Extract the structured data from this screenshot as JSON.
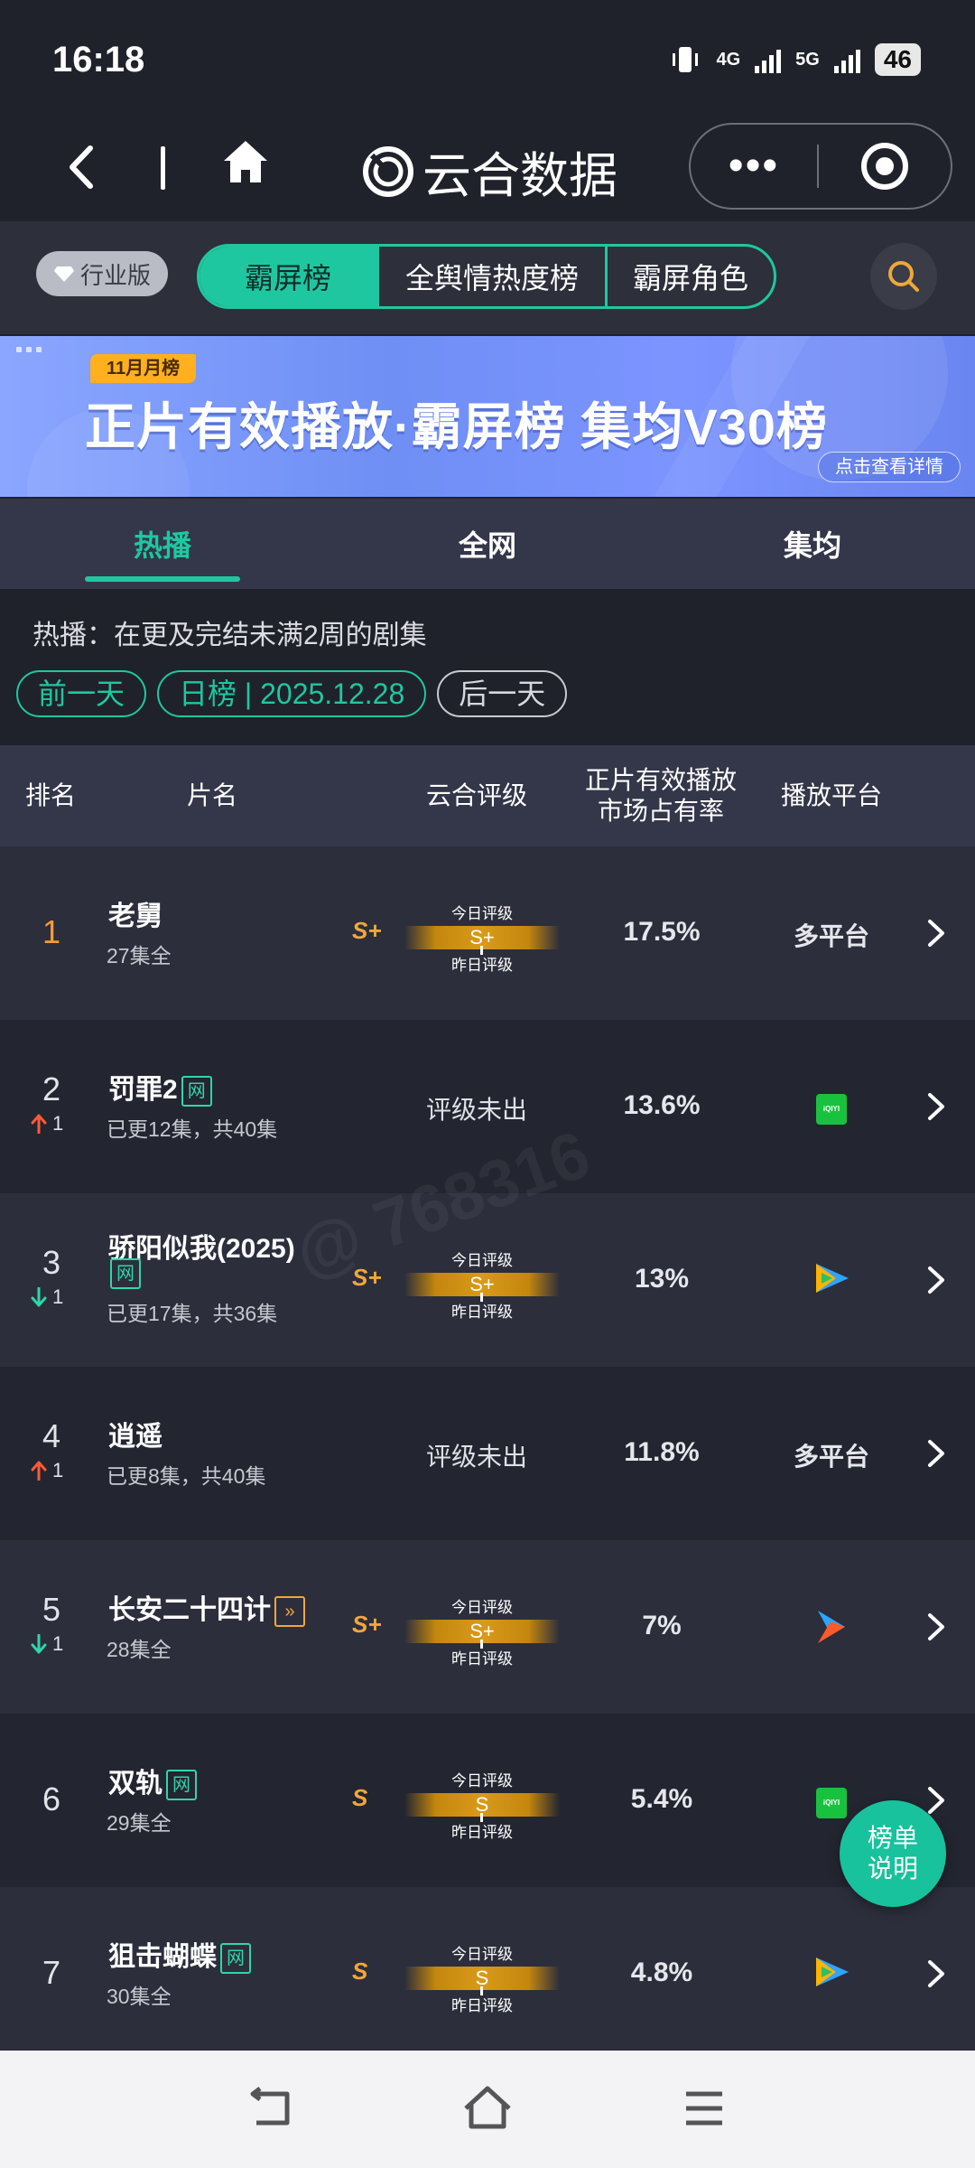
{
  "status": {
    "time": "16:18",
    "net1": "4G",
    "net2": "5G",
    "battery": "46"
  },
  "header": {
    "brand": "云合数据"
  },
  "top_tabs": {
    "edition": "行业版",
    "items": [
      "霸屏榜",
      "全舆情热度榜",
      "霸屏角色"
    ]
  },
  "banner": {
    "badge": "11月月榜",
    "title": "正片有效播放·霸屏榜 集均V30榜",
    "link": "点击查看详情"
  },
  "sub_tabs": [
    "热播",
    "全网",
    "集均"
  ],
  "description": "热播：在更及完结未满2周的剧集",
  "date_nav": {
    "prev": "前一天",
    "current": "日榜 | 2025.12.28",
    "next": "后一天"
  },
  "columns": [
    "排名",
    "片名",
    "云合评级",
    "正片有效播放\n市场占有率",
    "播放平台"
  ],
  "grade_labels": {
    "today": "今日评级",
    "yesterday": "昨日评级",
    "none": "评级未出"
  },
  "rows": [
    {
      "rank": "1",
      "change": "",
      "dir": "",
      "title": "老舅",
      "tag": "",
      "sub": "27集全",
      "grade": "S+",
      "bar": "S+",
      "share": "17.5%",
      "platform": "多平台",
      "platform_icon": ""
    },
    {
      "rank": "2",
      "change": "1",
      "dir": "up",
      "title": "罚罪2",
      "tag": "网",
      "sub": "已更12集，共40集",
      "grade": "",
      "bar": "",
      "share": "13.6%",
      "platform": "",
      "platform_icon": "iqiyi-icon"
    },
    {
      "rank": "3",
      "change": "1",
      "dir": "down",
      "title": "骄阳似我(2025)",
      "tag": "网",
      "sub": "已更17集，共36集",
      "grade": "S+",
      "bar": "S+",
      "share": "13%",
      "platform": "",
      "platform_icon": "tencent-video-icon"
    },
    {
      "rank": "4",
      "change": "1",
      "dir": "up",
      "title": "逍遥",
      "tag": "",
      "sub": "已更8集，共40集",
      "grade": "",
      "bar": "",
      "share": "11.8%",
      "platform": "多平台",
      "platform_icon": ""
    },
    {
      "rank": "5",
      "change": "1",
      "dir": "down",
      "title": "长安二十四计",
      "tag": "»",
      "sub": "28集全",
      "grade": "S+",
      "bar": "S+",
      "share": "7%",
      "platform": "",
      "platform_icon": "youku-icon"
    },
    {
      "rank": "6",
      "change": "",
      "dir": "",
      "title": "双轨",
      "tag": "网",
      "sub": "29集全",
      "grade": "S",
      "bar": "S",
      "share": "5.4%",
      "platform": "",
      "platform_icon": "iqiyi-icon"
    },
    {
      "rank": "7",
      "change": "",
      "dir": "",
      "title": "狙击蝴蝶",
      "tag": "网",
      "sub": "30集全",
      "grade": "S",
      "bar": "S",
      "share": "4.8%",
      "platform": "",
      "platform_icon": "tencent-video-icon"
    }
  ],
  "float_button": {
    "line1": "榜单",
    "line2": "说明"
  },
  "iqiyi_text": "iQIYI",
  "watermark": "@ 768316"
}
